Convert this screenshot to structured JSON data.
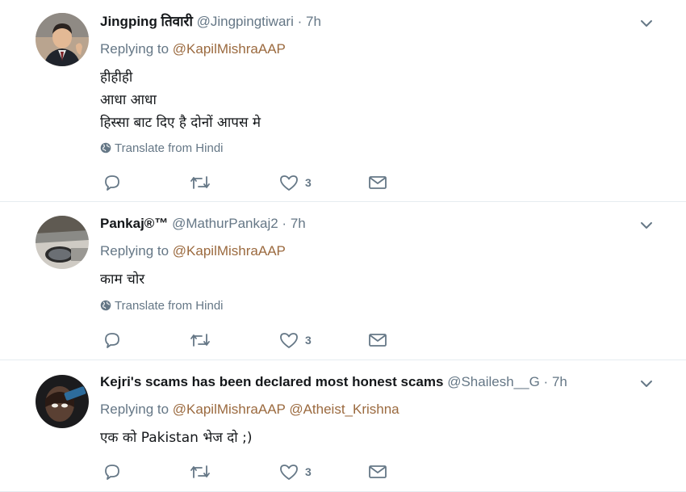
{
  "tweets": [
    {
      "display_name": "Jingping तिवारी",
      "handle": "@Jingpingtiwari",
      "separator": "·",
      "time": "7h",
      "replying_to_label": "Replying to",
      "mentions": [
        "@KapilMishraAAP"
      ],
      "lines": [
        "हीहीही",
        "आधा आधा",
        "हिस्सा बाट दिए है दोनों आपस मे"
      ],
      "translate_label": "Translate from Hindi",
      "likes": "3"
    },
    {
      "display_name": "Pankaj®™",
      "handle": "@MathurPankaj2",
      "separator": "·",
      "time": "7h",
      "replying_to_label": "Replying to",
      "mentions": [
        "@KapilMishraAAP"
      ],
      "lines": [
        "काम चोर"
      ],
      "translate_label": "Translate from Hindi",
      "likes": "3"
    },
    {
      "display_name": "Kejri's scams has been declared most honest scams",
      "handle": "@Shailesh__G",
      "separator": "·",
      "time": "7h",
      "replying_to_label": "Replying to",
      "mentions": [
        "@KapilMishraAAP",
        "@Atheist_Krishna"
      ],
      "lines": [
        "एक को Pakistan भेज दो ;)"
      ],
      "translate_label": "",
      "likes": "3"
    }
  ],
  "colors": {
    "mention": "#9b6a3f",
    "muted": "#657786",
    "text": "#14171a",
    "divider": "#e6ecf0"
  },
  "icons": [
    "chevron-down-icon",
    "globe-icon",
    "reply-icon",
    "retweet-icon",
    "heart-icon",
    "envelope-icon"
  ]
}
